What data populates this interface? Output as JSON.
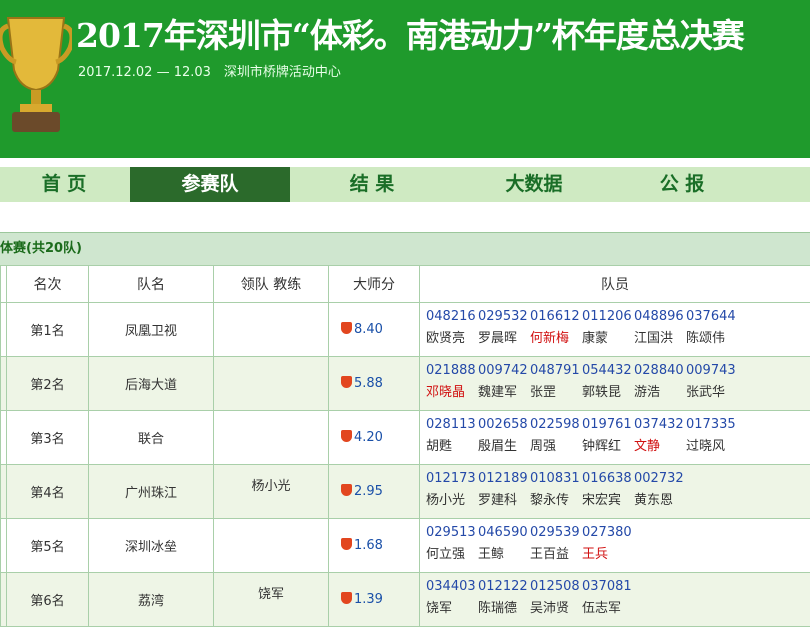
{
  "header": {
    "title": "2017年深圳市“体彩。南港动力”杯年度总决赛",
    "subtitle": "2017.12.02 — 12.03　深圳市桥牌活动中心"
  },
  "nav": [
    "首 页",
    "参赛队",
    "结 果",
    "大数据",
    "公 报"
  ],
  "section": {
    "title": "体赛(共20队)"
  },
  "table": {
    "headers": [
      "名次",
      "队名",
      "领队 教练",
      "大师分",
      "队员"
    ],
    "rows": [
      {
        "rank": "第1名",
        "team": "凤凰卫视",
        "staff": "",
        "score": "8.40",
        "ids": [
          "048216",
          "029532",
          "016612",
          "011206",
          "048896",
          "037644"
        ],
        "names": [
          "欧贤亮",
          "罗晨晖",
          "何新梅",
          "康蒙",
          "江国洪",
          "陈颂伟"
        ],
        "red": [
          false,
          false,
          true,
          false,
          false,
          false
        ]
      },
      {
        "rank": "第2名",
        "team": "后海大道",
        "staff": "",
        "score": "5.88",
        "ids": [
          "021888",
          "009742",
          "048791",
          "054432",
          "028840",
          "009743"
        ],
        "names": [
          "邓晓晶",
          "魏建军",
          "张罡",
          "郭轶昆",
          "游浩",
          "张武华"
        ],
        "red": [
          true,
          false,
          false,
          false,
          false,
          false
        ]
      },
      {
        "rank": "第3名",
        "team": "联合",
        "staff": "",
        "score": "4.20",
        "ids": [
          "028113",
          "002658",
          "022598",
          "019761",
          "037432",
          "017335"
        ],
        "names": [
          "胡甦",
          "殷眉生",
          "周强",
          "钟辉红",
          "文静",
          "过晓风"
        ],
        "red": [
          false,
          false,
          false,
          false,
          true,
          false
        ]
      },
      {
        "rank": "第4名",
        "team": "广州珠江",
        "staff": "杨小光",
        "score": "2.95",
        "ids": [
          "012173",
          "012189",
          "010831",
          "016638",
          "002732"
        ],
        "names": [
          "杨小光",
          "罗建科",
          "黎永传",
          "宋宏宾",
          "黄东恩"
        ],
        "red": [
          false,
          false,
          false,
          false,
          false
        ]
      },
      {
        "rank": "第5名",
        "team": "深圳冰垒",
        "staff": "",
        "score": "1.68",
        "ids": [
          "029513",
          "046590",
          "029539",
          "027380"
        ],
        "names": [
          "何立强",
          "王鲸",
          "王百益",
          "王兵"
        ],
        "red": [
          false,
          false,
          false,
          true
        ]
      },
      {
        "rank": "第6名",
        "team": "荔湾",
        "staff": "饶军",
        "score": "1.39",
        "ids": [
          "034403",
          "012122",
          "012508",
          "037081"
        ],
        "names": [
          "饶军",
          "陈瑞德",
          "吴沛贤",
          "伍志军"
        ],
        "red": [
          false,
          false,
          false,
          false
        ]
      }
    ]
  },
  "colors": {
    "header_bg": "#1f9a2c",
    "nav_bg": "#cfeac2",
    "nav_active": "#2b6a2b",
    "link_blue": "#2449a8",
    "highlight_red": "#d11010",
    "row_alt": "#eef5e6"
  }
}
